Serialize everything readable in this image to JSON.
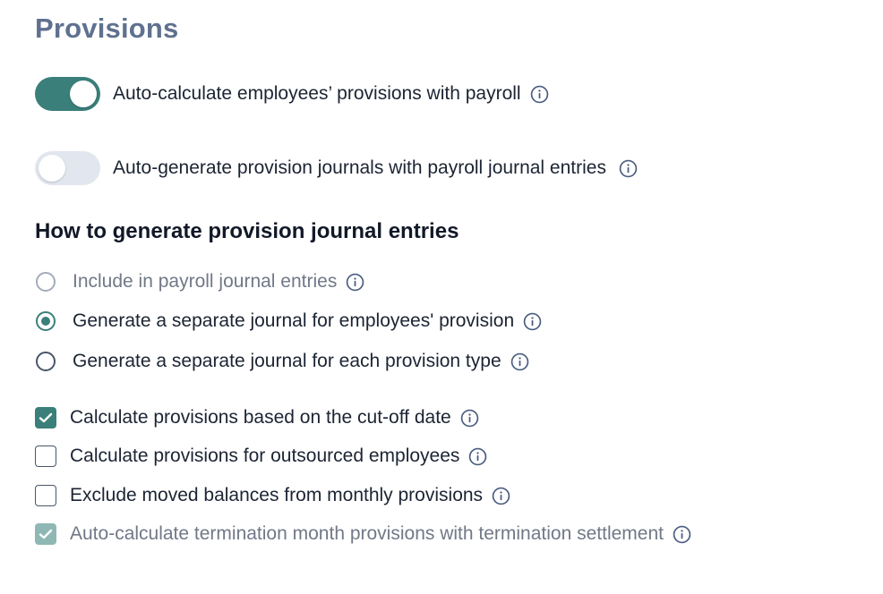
{
  "page": {
    "title": "Provisions"
  },
  "toggles": [
    {
      "label": "Auto-calculate employees’ provisions with payroll",
      "state": "on"
    },
    {
      "label": "Auto-generate provision journals with payroll journal entries",
      "state": "off"
    }
  ],
  "journal_section": {
    "heading": "How to generate provision journal entries",
    "options": [
      {
        "label": "Include in payroll journal entries",
        "state": "disabled"
      },
      {
        "label": "Generate a separate journal for employees' provision",
        "state": "selected"
      },
      {
        "label": "Generate a separate journal for each provision type",
        "state": "unselected"
      }
    ]
  },
  "checkboxes": [
    {
      "label": "Calculate provisions based on the cut-off date",
      "state": "checked"
    },
    {
      "label": "Calculate provisions for outsourced employees",
      "state": "unchecked"
    },
    {
      "label": "Exclude moved balances from monthly provisions",
      "state": "unchecked"
    },
    {
      "label": "Auto-calculate termination month provisions with termination settlement",
      "state": "checked-disabled"
    }
  ],
  "icons": {
    "info": "info-circle-icon",
    "check": "checkmark-icon"
  },
  "colors": {
    "accent": "#3b7f7a",
    "title": "#5f7190",
    "toggle_off": "#e2e6ee",
    "muted_text": "#717887"
  }
}
